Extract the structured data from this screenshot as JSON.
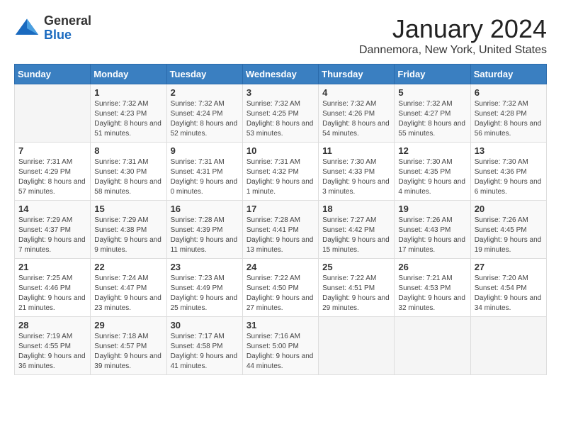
{
  "header": {
    "logo_line1": "General",
    "logo_line2": "Blue",
    "month": "January 2024",
    "location": "Dannemora, New York, United States"
  },
  "weekdays": [
    "Sunday",
    "Monday",
    "Tuesday",
    "Wednesday",
    "Thursday",
    "Friday",
    "Saturday"
  ],
  "weeks": [
    [
      {
        "day": "",
        "sunrise": "",
        "sunset": "",
        "daylight": ""
      },
      {
        "day": "1",
        "sunrise": "Sunrise: 7:32 AM",
        "sunset": "Sunset: 4:23 PM",
        "daylight": "Daylight: 8 hours and 51 minutes."
      },
      {
        "day": "2",
        "sunrise": "Sunrise: 7:32 AM",
        "sunset": "Sunset: 4:24 PM",
        "daylight": "Daylight: 8 hours and 52 minutes."
      },
      {
        "day": "3",
        "sunrise": "Sunrise: 7:32 AM",
        "sunset": "Sunset: 4:25 PM",
        "daylight": "Daylight: 8 hours and 53 minutes."
      },
      {
        "day": "4",
        "sunrise": "Sunrise: 7:32 AM",
        "sunset": "Sunset: 4:26 PM",
        "daylight": "Daylight: 8 hours and 54 minutes."
      },
      {
        "day": "5",
        "sunrise": "Sunrise: 7:32 AM",
        "sunset": "Sunset: 4:27 PM",
        "daylight": "Daylight: 8 hours and 55 minutes."
      },
      {
        "day": "6",
        "sunrise": "Sunrise: 7:32 AM",
        "sunset": "Sunset: 4:28 PM",
        "daylight": "Daylight: 8 hours and 56 minutes."
      }
    ],
    [
      {
        "day": "7",
        "sunrise": "Sunrise: 7:31 AM",
        "sunset": "Sunset: 4:29 PM",
        "daylight": "Daylight: 8 hours and 57 minutes."
      },
      {
        "day": "8",
        "sunrise": "Sunrise: 7:31 AM",
        "sunset": "Sunset: 4:30 PM",
        "daylight": "Daylight: 8 hours and 58 minutes."
      },
      {
        "day": "9",
        "sunrise": "Sunrise: 7:31 AM",
        "sunset": "Sunset: 4:31 PM",
        "daylight": "Daylight: 9 hours and 0 minutes."
      },
      {
        "day": "10",
        "sunrise": "Sunrise: 7:31 AM",
        "sunset": "Sunset: 4:32 PM",
        "daylight": "Daylight: 9 hours and 1 minute."
      },
      {
        "day": "11",
        "sunrise": "Sunrise: 7:30 AM",
        "sunset": "Sunset: 4:33 PM",
        "daylight": "Daylight: 9 hours and 3 minutes."
      },
      {
        "day": "12",
        "sunrise": "Sunrise: 7:30 AM",
        "sunset": "Sunset: 4:35 PM",
        "daylight": "Daylight: 9 hours and 4 minutes."
      },
      {
        "day": "13",
        "sunrise": "Sunrise: 7:30 AM",
        "sunset": "Sunset: 4:36 PM",
        "daylight": "Daylight: 9 hours and 6 minutes."
      }
    ],
    [
      {
        "day": "14",
        "sunrise": "Sunrise: 7:29 AM",
        "sunset": "Sunset: 4:37 PM",
        "daylight": "Daylight: 9 hours and 7 minutes."
      },
      {
        "day": "15",
        "sunrise": "Sunrise: 7:29 AM",
        "sunset": "Sunset: 4:38 PM",
        "daylight": "Daylight: 9 hours and 9 minutes."
      },
      {
        "day": "16",
        "sunrise": "Sunrise: 7:28 AM",
        "sunset": "Sunset: 4:39 PM",
        "daylight": "Daylight: 9 hours and 11 minutes."
      },
      {
        "day": "17",
        "sunrise": "Sunrise: 7:28 AM",
        "sunset": "Sunset: 4:41 PM",
        "daylight": "Daylight: 9 hours and 13 minutes."
      },
      {
        "day": "18",
        "sunrise": "Sunrise: 7:27 AM",
        "sunset": "Sunset: 4:42 PM",
        "daylight": "Daylight: 9 hours and 15 minutes."
      },
      {
        "day": "19",
        "sunrise": "Sunrise: 7:26 AM",
        "sunset": "Sunset: 4:43 PM",
        "daylight": "Daylight: 9 hours and 17 minutes."
      },
      {
        "day": "20",
        "sunrise": "Sunrise: 7:26 AM",
        "sunset": "Sunset: 4:45 PM",
        "daylight": "Daylight: 9 hours and 19 minutes."
      }
    ],
    [
      {
        "day": "21",
        "sunrise": "Sunrise: 7:25 AM",
        "sunset": "Sunset: 4:46 PM",
        "daylight": "Daylight: 9 hours and 21 minutes."
      },
      {
        "day": "22",
        "sunrise": "Sunrise: 7:24 AM",
        "sunset": "Sunset: 4:47 PM",
        "daylight": "Daylight: 9 hours and 23 minutes."
      },
      {
        "day": "23",
        "sunrise": "Sunrise: 7:23 AM",
        "sunset": "Sunset: 4:49 PM",
        "daylight": "Daylight: 9 hours and 25 minutes."
      },
      {
        "day": "24",
        "sunrise": "Sunrise: 7:22 AM",
        "sunset": "Sunset: 4:50 PM",
        "daylight": "Daylight: 9 hours and 27 minutes."
      },
      {
        "day": "25",
        "sunrise": "Sunrise: 7:22 AM",
        "sunset": "Sunset: 4:51 PM",
        "daylight": "Daylight: 9 hours and 29 minutes."
      },
      {
        "day": "26",
        "sunrise": "Sunrise: 7:21 AM",
        "sunset": "Sunset: 4:53 PM",
        "daylight": "Daylight: 9 hours and 32 minutes."
      },
      {
        "day": "27",
        "sunrise": "Sunrise: 7:20 AM",
        "sunset": "Sunset: 4:54 PM",
        "daylight": "Daylight: 9 hours and 34 minutes."
      }
    ],
    [
      {
        "day": "28",
        "sunrise": "Sunrise: 7:19 AM",
        "sunset": "Sunset: 4:55 PM",
        "daylight": "Daylight: 9 hours and 36 minutes."
      },
      {
        "day": "29",
        "sunrise": "Sunrise: 7:18 AM",
        "sunset": "Sunset: 4:57 PM",
        "daylight": "Daylight: 9 hours and 39 minutes."
      },
      {
        "day": "30",
        "sunrise": "Sunrise: 7:17 AM",
        "sunset": "Sunset: 4:58 PM",
        "daylight": "Daylight: 9 hours and 41 minutes."
      },
      {
        "day": "31",
        "sunrise": "Sunrise: 7:16 AM",
        "sunset": "Sunset: 5:00 PM",
        "daylight": "Daylight: 9 hours and 44 minutes."
      },
      {
        "day": "",
        "sunrise": "",
        "sunset": "",
        "daylight": ""
      },
      {
        "day": "",
        "sunrise": "",
        "sunset": "",
        "daylight": ""
      },
      {
        "day": "",
        "sunrise": "",
        "sunset": "",
        "daylight": ""
      }
    ]
  ]
}
